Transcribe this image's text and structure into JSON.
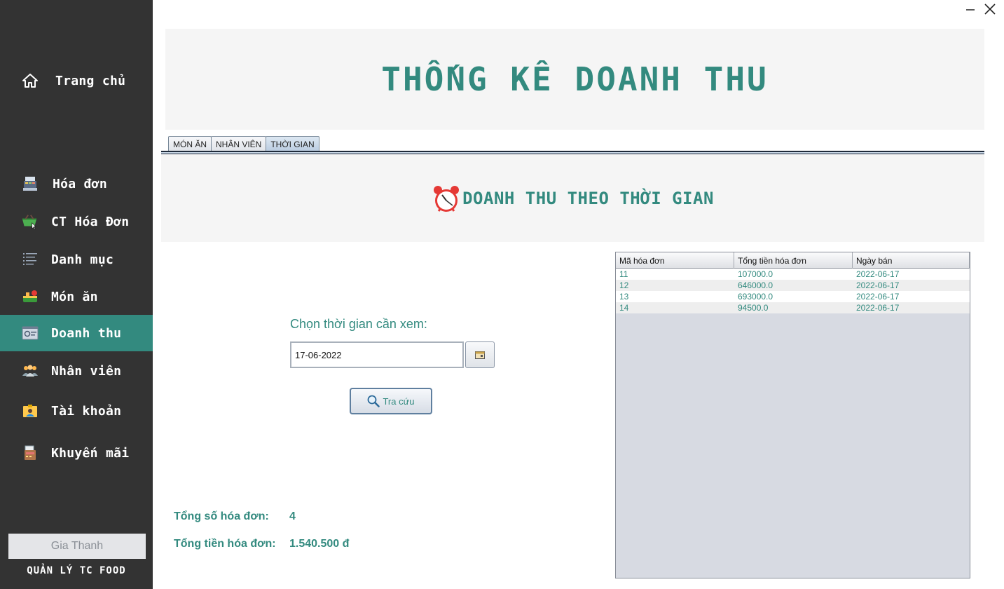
{
  "sidebar": {
    "items": [
      {
        "label": "Trang chủ",
        "icon": "home-icon"
      },
      {
        "label": "Hóa đơn",
        "icon": "cash-register-icon"
      },
      {
        "label": "CT Hóa Đơn",
        "icon": "basket-icon"
      },
      {
        "label": "Danh mục",
        "icon": "list-icon"
      },
      {
        "label": "Món ăn",
        "icon": "food-icon"
      },
      {
        "label": "Doanh thu",
        "icon": "revenue-icon"
      },
      {
        "label": "Nhân viên",
        "icon": "staff-icon"
      },
      {
        "label": "Tài khoản",
        "icon": "account-icon"
      },
      {
        "label": "Khuyến mãi",
        "icon": "promotion-icon"
      }
    ],
    "active_index": 5,
    "user": "Gia Thanh",
    "app_name": "QUẢN LÝ TC FOOD"
  },
  "header": {
    "title": "THỐNG KÊ DOANH THU"
  },
  "tabs": [
    {
      "label": "MÓN ĂN"
    },
    {
      "label": "NHÂN VIÊN"
    },
    {
      "label": "THỜI GIAN"
    }
  ],
  "active_tab": 2,
  "panel": {
    "title": "DOANH THU THEO THỜI GIAN",
    "choose_label": "Chọn thời gian cần xem:",
    "date_value": "17-06-2022",
    "search_label": "Tra cứu"
  },
  "stats": {
    "count_label": "Tổng số hóa đơn:",
    "count_value": "4",
    "total_label": "Tổng tiền hóa đơn:",
    "total_value": "1.540.500 đ"
  },
  "table": {
    "headers": [
      "Mã hóa đơn",
      "Tổng tiền hóa đơn",
      "Ngày bán"
    ],
    "rows": [
      [
        "11",
        "107000.0",
        "2022-06-17"
      ],
      [
        "12",
        "646000.0",
        "2022-06-17"
      ],
      [
        "13",
        "693000.0",
        "2022-06-17"
      ],
      [
        "14",
        "94500.0",
        "2022-06-17"
      ]
    ]
  },
  "colors": {
    "accent": "#338a7f",
    "sidebar": "#333333"
  }
}
